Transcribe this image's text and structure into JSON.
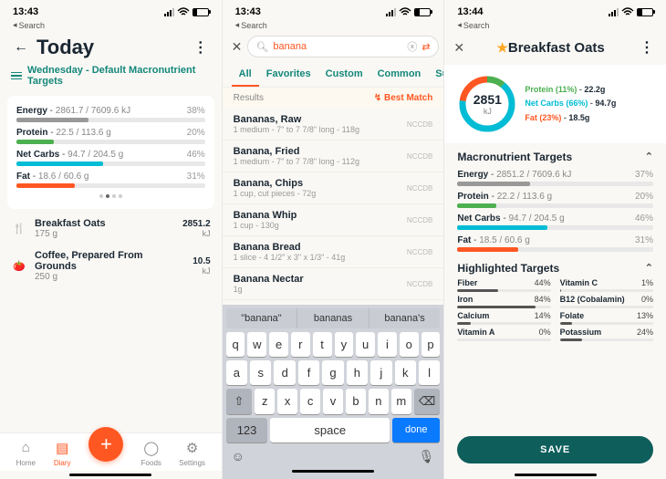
{
  "status": {
    "time1": "13:43",
    "time2": "13:43",
    "time3": "13:44",
    "batt": "30",
    "search_hint": "Search"
  },
  "pane1": {
    "title": "Today",
    "subtitle": "Wednesday - Default Macronutrient Targets",
    "macros": [
      {
        "label": "Energy",
        "val": "2861.7 / 7609.6 kJ",
        "pct": "38%",
        "width": 38,
        "color": "#999"
      },
      {
        "label": "Protein",
        "val": "22.5 / 113.6 g",
        "pct": "20%",
        "width": 20,
        "color": "#4caf50"
      },
      {
        "label": "Net Carbs",
        "val": "94.7 / 204.5 g",
        "pct": "46%",
        "width": 46,
        "color": "#00bcd4"
      },
      {
        "label": "Fat",
        "val": "18.6 / 60.6 g",
        "pct": "31%",
        "width": 31,
        "color": "#ff5722"
      }
    ],
    "foods": [
      {
        "icon": "🍴",
        "name": "Breakfast Oats",
        "amt": "175 g",
        "kj": "2851.2"
      },
      {
        "icon": "🍅",
        "name": "Coffee, Prepared From Grounds",
        "amt": "250 g",
        "kj": "10.5"
      }
    ],
    "tabs": [
      {
        "icon": "⌂",
        "label": "Home"
      },
      {
        "icon": "▤",
        "label": "Diary"
      },
      {
        "icon": "○",
        "label": "Foods"
      },
      {
        "icon": "⚙",
        "label": "Settings"
      }
    ]
  },
  "pane2": {
    "query": "banana",
    "tabs": [
      "All",
      "Favorites",
      "Custom",
      "Common",
      "Su"
    ],
    "results_label": "Results",
    "best_match": "Best Match",
    "results": [
      {
        "name": "Bananas, Raw",
        "detail": "1 medium - 7\" to 7 7/8\" long - 118g",
        "db": "NCCDB"
      },
      {
        "name": "Banana, Fried",
        "detail": "1 medium - 7\" to 7 7/8\" long - 112g",
        "db": "NCCDB"
      },
      {
        "name": "Banana, Chips",
        "detail": "1 cup, cut pieces - 72g",
        "db": "NCCDB"
      },
      {
        "name": "Banana Whip",
        "detail": "1 cup - 130g",
        "db": "NCCDB"
      },
      {
        "name": "Banana Bread",
        "detail": "1 slice - 4 1/2\" x 3\" x 1/3\" - 41g",
        "db": "NCCDB"
      },
      {
        "name": "Banana Nectar",
        "detail": "1g",
        "db": "NCCDB"
      }
    ],
    "suggestions": [
      "\"banana\"",
      "bananas",
      "banana's"
    ],
    "rows": [
      [
        "q",
        "w",
        "e",
        "r",
        "t",
        "y",
        "u",
        "i",
        "o",
        "p"
      ],
      [
        "a",
        "s",
        "d",
        "f",
        "g",
        "h",
        "j",
        "k",
        "l"
      ],
      [
        "z",
        "x",
        "c",
        "v",
        "b",
        "n",
        "m"
      ]
    ],
    "k123": "123",
    "space": "space",
    "done": "done"
  },
  "pane3": {
    "title": "Breakfast Oats",
    "energy": "2851",
    "unit": "kJ",
    "legend": [
      {
        "label": "Protein (11%)",
        "val": "22.2g",
        "cls": "p"
      },
      {
        "label": "Net Carbs (66%)",
        "val": "94.7g",
        "cls": "c"
      },
      {
        "label": "Fat (23%)",
        "val": "18.5g",
        "cls": "f"
      }
    ],
    "sect1": "Macronutrient Targets",
    "macros": [
      {
        "label": "Energy",
        "val": "2851.2 / 7609.6 kJ",
        "pct": "37%",
        "width": 37,
        "color": "#999"
      },
      {
        "label": "Protein",
        "val": "22.2 / 113.6 g",
        "pct": "20%",
        "width": 20,
        "color": "#4caf50"
      },
      {
        "label": "Net Carbs",
        "val": "94.7 / 204.5 g",
        "pct": "46%",
        "width": 46,
        "color": "#00bcd4"
      },
      {
        "label": "Fat",
        "val": "18.5 / 60.6 g",
        "pct": "31%",
        "width": 31,
        "color": "#ff5722"
      }
    ],
    "sect2": "Highlighted Targets",
    "highlights": [
      {
        "name": "Fiber",
        "pct": "44%",
        "width": 44
      },
      {
        "name": "Vitamin C",
        "pct": "1%",
        "width": 1
      },
      {
        "name": "Iron",
        "pct": "84%",
        "width": 84
      },
      {
        "name": "B12 (Cobalamin)",
        "pct": "0%",
        "width": 0
      },
      {
        "name": "Calcium",
        "pct": "14%",
        "width": 14
      },
      {
        "name": "Folate",
        "pct": "13%",
        "width": 13
      },
      {
        "name": "Vitamin A",
        "pct": "0%",
        "width": 0
      },
      {
        "name": "Potassium",
        "pct": "24%",
        "width": 24
      }
    ],
    "save": "SAVE"
  },
  "chart_data": {
    "type": "pie",
    "title": "Breakfast Oats macronutrient breakdown",
    "series": [
      {
        "name": "Protein",
        "value": 11
      },
      {
        "name": "Net Carbs",
        "value": 66
      },
      {
        "name": "Fat",
        "value": 23
      }
    ],
    "center_value": 2851,
    "center_unit": "kJ"
  }
}
